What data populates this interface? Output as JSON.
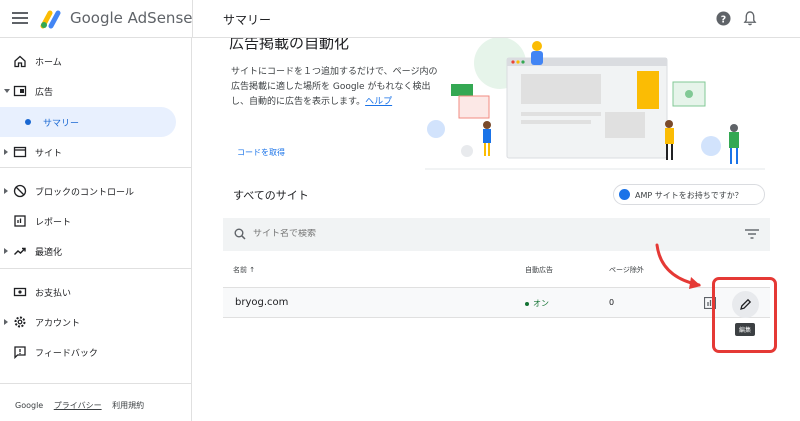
{
  "header": {
    "brand": "Google AdSense",
    "page_title": "サマリー"
  },
  "sidebar": {
    "items": [
      {
        "label": "ホーム",
        "icon": "home-icon"
      },
      {
        "label": "広告",
        "icon": "ads-icon"
      },
      {
        "label": "サマリー",
        "icon": "dot"
      },
      {
        "label": "サイト",
        "icon": "sites-icon"
      },
      {
        "label": "ブロックのコントロール",
        "icon": "block-icon"
      },
      {
        "label": "レポート",
        "icon": "report-icon"
      },
      {
        "label": "最適化",
        "icon": "optimize-icon"
      },
      {
        "label": "お支払い",
        "icon": "payments-icon"
      },
      {
        "label": "アカウント",
        "icon": "gear-icon"
      },
      {
        "label": "フィードバック",
        "icon": "feedback-icon"
      }
    ],
    "footer": {
      "google": "Google",
      "privacy": "プライバシー",
      "terms": "利用規約"
    }
  },
  "hero": {
    "title": "広告掲載の自動化",
    "text": "サイトにコードを１つ追加するだけで、ページ内の広告掲載に適した場所を Google がもれなく検出し、自動的に広告を表示します。",
    "help_link": "ヘルプ",
    "get_code": "コードを取得"
  },
  "sites": {
    "heading": "すべてのサイト",
    "amp_button": "AMP サイトをお持ちですか？",
    "search_placeholder": "サイト名で検索",
    "columns": {
      "name": "名前 ↑",
      "auto_ads": "自動広告",
      "excluded": "ページ除外"
    },
    "rows": [
      {
        "site": "bryog.com",
        "auto_ads": "オン",
        "excluded": "0"
      }
    ],
    "edit_tooltip": "編集"
  },
  "colors": {
    "accent": "#1a73e8",
    "active_bg": "#e8f0fe",
    "status_on": "#137333",
    "highlight": "#e53935"
  }
}
